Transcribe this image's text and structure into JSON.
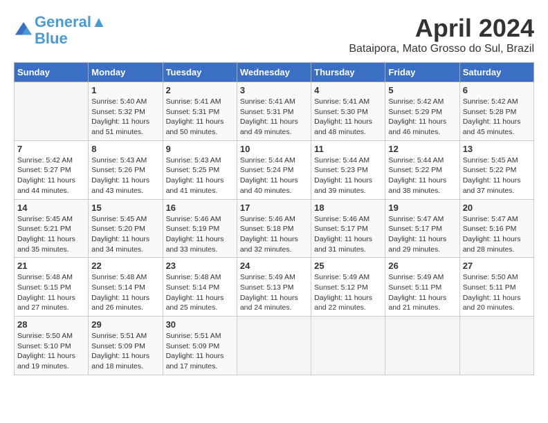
{
  "header": {
    "logo_line1": "General",
    "logo_line2": "Blue",
    "title": "April 2024",
    "subtitle": "Bataipora, Mato Grosso do Sul, Brazil"
  },
  "weekdays": [
    "Sunday",
    "Monday",
    "Tuesday",
    "Wednesday",
    "Thursday",
    "Friday",
    "Saturday"
  ],
  "weeks": [
    [
      {
        "day": "",
        "info": ""
      },
      {
        "day": "1",
        "info": "Sunrise: 5:40 AM\nSunset: 5:32 PM\nDaylight: 11 hours\nand 51 minutes."
      },
      {
        "day": "2",
        "info": "Sunrise: 5:41 AM\nSunset: 5:31 PM\nDaylight: 11 hours\nand 50 minutes."
      },
      {
        "day": "3",
        "info": "Sunrise: 5:41 AM\nSunset: 5:31 PM\nDaylight: 11 hours\nand 49 minutes."
      },
      {
        "day": "4",
        "info": "Sunrise: 5:41 AM\nSunset: 5:30 PM\nDaylight: 11 hours\nand 48 minutes."
      },
      {
        "day": "5",
        "info": "Sunrise: 5:42 AM\nSunset: 5:29 PM\nDaylight: 11 hours\nand 46 minutes."
      },
      {
        "day": "6",
        "info": "Sunrise: 5:42 AM\nSunset: 5:28 PM\nDaylight: 11 hours\nand 45 minutes."
      }
    ],
    [
      {
        "day": "7",
        "info": "Sunrise: 5:42 AM\nSunset: 5:27 PM\nDaylight: 11 hours\nand 44 minutes."
      },
      {
        "day": "8",
        "info": "Sunrise: 5:43 AM\nSunset: 5:26 PM\nDaylight: 11 hours\nand 43 minutes."
      },
      {
        "day": "9",
        "info": "Sunrise: 5:43 AM\nSunset: 5:25 PM\nDaylight: 11 hours\nand 41 minutes."
      },
      {
        "day": "10",
        "info": "Sunrise: 5:44 AM\nSunset: 5:24 PM\nDaylight: 11 hours\nand 40 minutes."
      },
      {
        "day": "11",
        "info": "Sunrise: 5:44 AM\nSunset: 5:23 PM\nDaylight: 11 hours\nand 39 minutes."
      },
      {
        "day": "12",
        "info": "Sunrise: 5:44 AM\nSunset: 5:22 PM\nDaylight: 11 hours\nand 38 minutes."
      },
      {
        "day": "13",
        "info": "Sunrise: 5:45 AM\nSunset: 5:22 PM\nDaylight: 11 hours\nand 37 minutes."
      }
    ],
    [
      {
        "day": "14",
        "info": "Sunrise: 5:45 AM\nSunset: 5:21 PM\nDaylight: 11 hours\nand 35 minutes."
      },
      {
        "day": "15",
        "info": "Sunrise: 5:45 AM\nSunset: 5:20 PM\nDaylight: 11 hours\nand 34 minutes."
      },
      {
        "day": "16",
        "info": "Sunrise: 5:46 AM\nSunset: 5:19 PM\nDaylight: 11 hours\nand 33 minutes."
      },
      {
        "day": "17",
        "info": "Sunrise: 5:46 AM\nSunset: 5:18 PM\nDaylight: 11 hours\nand 32 minutes."
      },
      {
        "day": "18",
        "info": "Sunrise: 5:46 AM\nSunset: 5:17 PM\nDaylight: 11 hours\nand 31 minutes."
      },
      {
        "day": "19",
        "info": "Sunrise: 5:47 AM\nSunset: 5:17 PM\nDaylight: 11 hours\nand 29 minutes."
      },
      {
        "day": "20",
        "info": "Sunrise: 5:47 AM\nSunset: 5:16 PM\nDaylight: 11 hours\nand 28 minutes."
      }
    ],
    [
      {
        "day": "21",
        "info": "Sunrise: 5:48 AM\nSunset: 5:15 PM\nDaylight: 11 hours\nand 27 minutes."
      },
      {
        "day": "22",
        "info": "Sunrise: 5:48 AM\nSunset: 5:14 PM\nDaylight: 11 hours\nand 26 minutes."
      },
      {
        "day": "23",
        "info": "Sunrise: 5:48 AM\nSunset: 5:14 PM\nDaylight: 11 hours\nand 25 minutes."
      },
      {
        "day": "24",
        "info": "Sunrise: 5:49 AM\nSunset: 5:13 PM\nDaylight: 11 hours\nand 24 minutes."
      },
      {
        "day": "25",
        "info": "Sunrise: 5:49 AM\nSunset: 5:12 PM\nDaylight: 11 hours\nand 22 minutes."
      },
      {
        "day": "26",
        "info": "Sunrise: 5:49 AM\nSunset: 5:11 PM\nDaylight: 11 hours\nand 21 minutes."
      },
      {
        "day": "27",
        "info": "Sunrise: 5:50 AM\nSunset: 5:11 PM\nDaylight: 11 hours\nand 20 minutes."
      }
    ],
    [
      {
        "day": "28",
        "info": "Sunrise: 5:50 AM\nSunset: 5:10 PM\nDaylight: 11 hours\nand 19 minutes."
      },
      {
        "day": "29",
        "info": "Sunrise: 5:51 AM\nSunset: 5:09 PM\nDaylight: 11 hours\nand 18 minutes."
      },
      {
        "day": "30",
        "info": "Sunrise: 5:51 AM\nSunset: 5:09 PM\nDaylight: 11 hours\nand 17 minutes."
      },
      {
        "day": "",
        "info": ""
      },
      {
        "day": "",
        "info": ""
      },
      {
        "day": "",
        "info": ""
      },
      {
        "day": "",
        "info": ""
      }
    ]
  ]
}
